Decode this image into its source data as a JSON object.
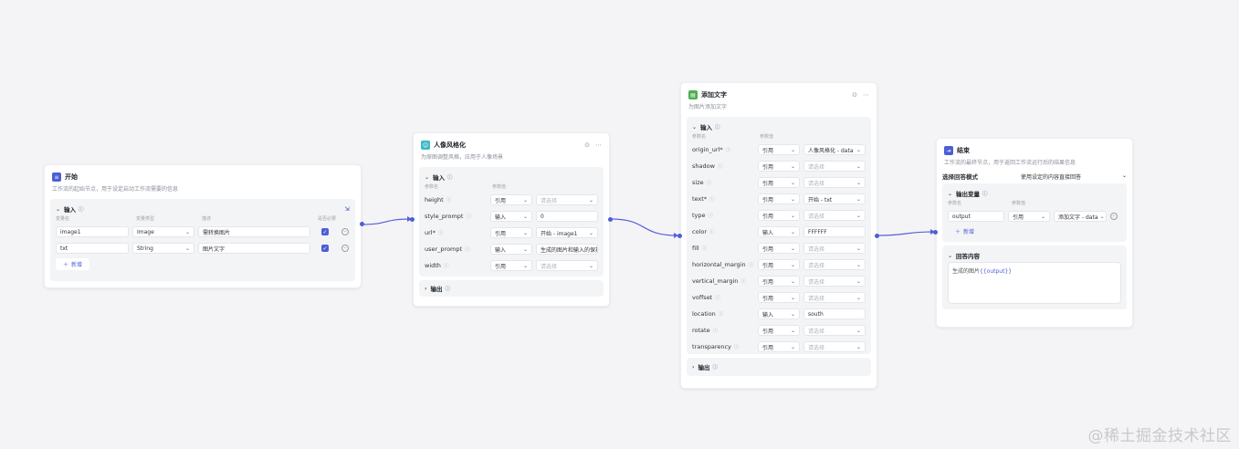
{
  "colors": {
    "accent": "#4c5fd5",
    "start_icon": "#4c5fd5",
    "portrait_icon": "#3db8c6",
    "text_icon": "#4caf50",
    "end_icon": "#4c5fd5"
  },
  "start": {
    "title": "开始",
    "desc": "工作流的起始节点，用于设定启动工作流需要的信息",
    "input_label": "输入",
    "cols": [
      "变量名",
      "变量类型",
      "描述",
      "是否必要"
    ],
    "rows": [
      {
        "name": "image1",
        "type": "Image",
        "desc": "需转换图片"
      },
      {
        "name": "txt",
        "type": "String",
        "desc": "图片文字"
      }
    ],
    "add_label": "新增"
  },
  "portrait": {
    "title": "人像风格化",
    "desc": "为原图调整风格，应用于人像场景",
    "input_label": "输入",
    "cols": [
      "参数名",
      "参数值"
    ],
    "rows": [
      {
        "name": "height",
        "mode": "引用",
        "value": "请选择",
        "ph": true
      },
      {
        "name": "style_prompt",
        "mode": "输入",
        "value": "0",
        "ph": false
      },
      {
        "name": "url*",
        "mode": "引用",
        "value": "开始 - image1",
        "ph": false
      },
      {
        "name": "user_prompt",
        "mode": "输入",
        "value": "生成的图片和输入的保持一致",
        "ph": false
      },
      {
        "name": "width",
        "mode": "引用",
        "value": "请选择",
        "ph": true
      }
    ],
    "output_label": "输出"
  },
  "addtext": {
    "title": "添加文字",
    "desc": "为图片添加文字",
    "input_label": "输入",
    "cols": [
      "参数名",
      "参数值"
    ],
    "rows": [
      {
        "name": "origin_url*",
        "mode": "引用",
        "value": "人像风格化 - data",
        "ph": false
      },
      {
        "name": "shadow",
        "mode": "引用",
        "value": "请选择",
        "ph": true
      },
      {
        "name": "size",
        "mode": "引用",
        "value": "请选择",
        "ph": true
      },
      {
        "name": "text*",
        "mode": "引用",
        "value": "开始 - txt",
        "ph": false
      },
      {
        "name": "type",
        "mode": "引用",
        "value": "请选择",
        "ph": true
      },
      {
        "name": "color",
        "mode": "输入",
        "value": "FFFFFF",
        "ph": false
      },
      {
        "name": "fill",
        "mode": "引用",
        "value": "请选择",
        "ph": true
      },
      {
        "name": "horizontal_margin",
        "mode": "引用",
        "value": "请选择",
        "ph": true
      },
      {
        "name": "vertical_margin",
        "mode": "引用",
        "value": "请选择",
        "ph": true
      },
      {
        "name": "voffset",
        "mode": "引用",
        "value": "请选择",
        "ph": true
      },
      {
        "name": "location",
        "mode": "输入",
        "value": "south",
        "ph": false
      },
      {
        "name": "rotate",
        "mode": "引用",
        "value": "请选择",
        "ph": true
      },
      {
        "name": "transparency",
        "mode": "引用",
        "value": "请选择",
        "ph": true
      }
    ],
    "output_label": "输出"
  },
  "end": {
    "title": "结束",
    "desc": "工作流的最终节点，用于返回工作流运行后的结果信息",
    "mode_label": "选择回答模式",
    "mode_value": "使用设定的内容直接回答",
    "out_label": "输出变量",
    "cols": [
      "参数名",
      "参数值"
    ],
    "row": {
      "name": "output",
      "mode": "引用",
      "value": "添加文字 - data"
    },
    "add_label": "新增",
    "answer_label": "回答内容",
    "answer_prefix": "生成的图片",
    "answer_var": "{{output}}"
  },
  "watermark": "@稀土掘金技术社区"
}
